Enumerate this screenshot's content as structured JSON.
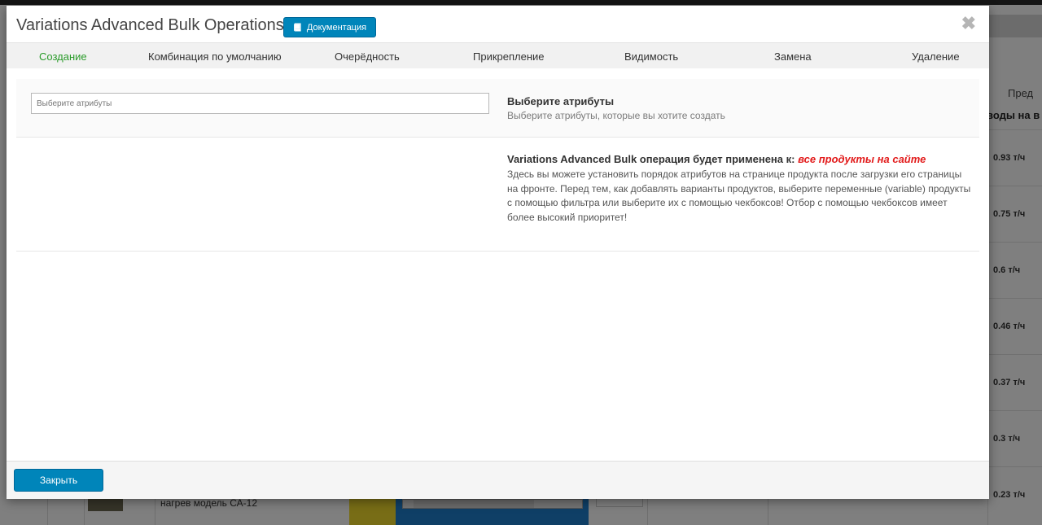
{
  "background": {
    "col_header_1": "Пред",
    "col_header_2": "воды на в",
    "rows": [
      "0.93 т/ч",
      "0.75 т/ч",
      "0.6 т/ч",
      "0.46 т/ч",
      "0.37 т/ч",
      "0.3 т/ч",
      "0.23 т/ч"
    ],
    "bottom_text": "нагрев модель СА-12"
  },
  "modal": {
    "title": "Variations Advanced Bulk Operations -",
    "doc_button_label": "Документация",
    "close_glyph": "✖"
  },
  "tabs": [
    {
      "label": "Создание",
      "active": true
    },
    {
      "label": "Комбинация по умолчанию",
      "active": false
    },
    {
      "label": "Очерёдность",
      "active": false
    },
    {
      "label": "Прикрепление",
      "active": false
    },
    {
      "label": "Видимость",
      "active": false
    },
    {
      "label": "Замена",
      "active": false
    },
    {
      "label": "Удаление",
      "active": false
    }
  ],
  "attributes": {
    "placeholder": "Выберите атрибуты",
    "title": "Выберите атрибуты",
    "description": "Выберите атрибуты, которые вы хотите создать"
  },
  "operation": {
    "heading": "Variations Advanced Bulk операция будет применена к:",
    "target": "все продукты на сайте",
    "description": "Здесь вы можете установить порядок атрибутов на странице продукта после загрузки его страницы на фронте. Перед тем, как добавлять варианты продуктов, выберите переменные (variable) продукты с помощью фильтра или выберите их с помощью чекбоксов! Отбор с помощью чекбоксов имеет более высокий приоритет!"
  },
  "footer": {
    "close_label": "Закрыть"
  },
  "colors": {
    "primary_button": "#0085ba",
    "active_tab": "#2a9b2a",
    "highlight": "#e21b1b"
  }
}
